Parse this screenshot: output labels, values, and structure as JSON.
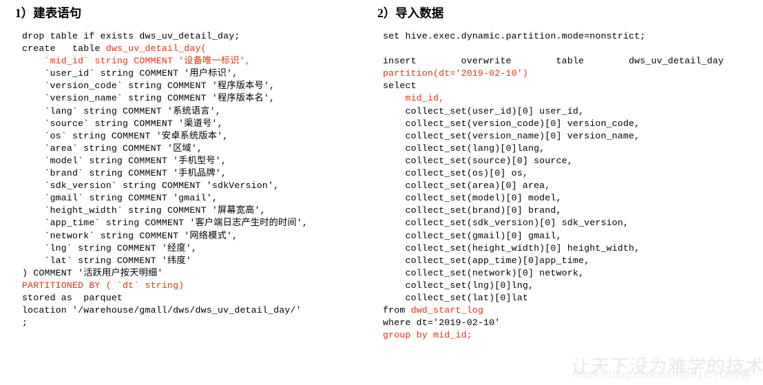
{
  "document": {
    "left_column": {
      "heading": "1）建表语句",
      "code_lines": [
        [
          {
            "t": "drop table if exists dws_uv_detail_day;",
            "c": "black"
          }
        ],
        [
          {
            "t": "create   table ",
            "c": "black"
          },
          {
            "t": "dws_uv_detail_day(",
            "c": "red"
          }
        ],
        [
          {
            "t": "    `mid_id` string COMMENT '设备唯一标识',",
            "c": "red"
          }
        ],
        [
          {
            "t": "    `user_id` string COMMENT '用户标识',",
            "c": "black"
          }
        ],
        [
          {
            "t": "    `version_code` string COMMENT '程序版本号',",
            "c": "black"
          }
        ],
        [
          {
            "t": "    `version_name` string COMMENT '程序版本名',",
            "c": "black"
          }
        ],
        [
          {
            "t": "    `lang` string COMMENT '系统语言',",
            "c": "black"
          }
        ],
        [
          {
            "t": "    `source` string COMMENT '渠道号',",
            "c": "black"
          }
        ],
        [
          {
            "t": "    `os` string COMMENT '安卓系统版本',",
            "c": "black"
          }
        ],
        [
          {
            "t": "    `area` string COMMENT '区域',",
            "c": "black"
          }
        ],
        [
          {
            "t": "    `model` string COMMENT '手机型号',",
            "c": "black"
          }
        ],
        [
          {
            "t": "    `brand` string COMMENT '手机品牌',",
            "c": "black"
          }
        ],
        [
          {
            "t": "    `sdk_version` string COMMENT 'sdkVersion',",
            "c": "black"
          }
        ],
        [
          {
            "t": "    `gmail` string COMMENT 'gmail',",
            "c": "black"
          }
        ],
        [
          {
            "t": "    `height_width` string COMMENT '屏幕宽高',",
            "c": "black"
          }
        ],
        [
          {
            "t": "    `app_time` string COMMENT '客户端日志产生时的时间',",
            "c": "black"
          }
        ],
        [
          {
            "t": "    `network` string COMMENT '网络模式',",
            "c": "black"
          }
        ],
        [
          {
            "t": "    `lng` string COMMENT '经度',",
            "c": "black"
          }
        ],
        [
          {
            "t": "    `lat` string COMMENT '纬度'",
            "c": "black"
          }
        ],
        [
          {
            "t": ") COMMENT '活跃用户按天明细'",
            "c": "black"
          }
        ],
        [
          {
            "t": "PARTITIONED BY ( `dt` string)",
            "c": "red"
          }
        ],
        [
          {
            "t": "stored as  parquet",
            "c": "black"
          }
        ],
        [
          {
            "t": "location '/warehouse/gmall/dws/dws_uv_detail_day/'",
            "c": "black"
          }
        ],
        [
          {
            "t": ";",
            "c": "black"
          }
        ]
      ]
    },
    "right_column": {
      "heading": "2）导入数据",
      "code_lines": [
        [
          {
            "t": "set hive.exec.dynamic.partition.mode=nonstrict;",
            "c": "black"
          }
        ],
        [
          {
            "t": "",
            "c": "black"
          }
        ],
        [
          {
            "t": "insert        overwrite        table        dws_uv_detail_day",
            "c": "black"
          }
        ],
        [
          {
            "t": "partition(dt='2019-02-10')",
            "c": "red"
          }
        ],
        [
          {
            "t": "select",
            "c": "black"
          }
        ],
        [
          {
            "t": "    mid_id,",
            "c": "red"
          }
        ],
        [
          {
            "t": "    collect_set(user_id)[0] user_id,",
            "c": "black"
          }
        ],
        [
          {
            "t": "    collect_set(version_code)[0] version_code,",
            "c": "black"
          }
        ],
        [
          {
            "t": "    collect_set(version_name)[0] version_name,",
            "c": "black"
          }
        ],
        [
          {
            "t": "    collect_set(lang)[0]lang,",
            "c": "black"
          }
        ],
        [
          {
            "t": "    collect_set(source)[0] source,",
            "c": "black"
          }
        ],
        [
          {
            "t": "    collect_set(os)[0] os,",
            "c": "black"
          }
        ],
        [
          {
            "t": "    collect_set(area)[0] area,",
            "c": "black"
          }
        ],
        [
          {
            "t": "    collect_set(model)[0] model,",
            "c": "black"
          }
        ],
        [
          {
            "t": "    collect_set(brand)[0] brand,",
            "c": "black"
          }
        ],
        [
          {
            "t": "    collect_set(sdk_version)[0] sdk_version,",
            "c": "black"
          }
        ],
        [
          {
            "t": "    collect_set(gmail)[0] gmail,",
            "c": "black"
          }
        ],
        [
          {
            "t": "    collect_set(height_width)[0] height_width,",
            "c": "black"
          }
        ],
        [
          {
            "t": "    collect_set(app_time)[0]app_time,",
            "c": "black"
          }
        ],
        [
          {
            "t": "    collect_set(network)[0] network,",
            "c": "black"
          }
        ],
        [
          {
            "t": "    collect_set(lng)[0]lng,",
            "c": "black"
          }
        ],
        [
          {
            "t": "    collect_set(lat)[0]lat",
            "c": "black"
          }
        ],
        [
          {
            "t": "from ",
            "c": "black"
          },
          {
            "t": "dwd_start_log",
            "c": "red"
          }
        ],
        [
          {
            "t": "where dt='2019-02-10'",
            "c": "black"
          }
        ],
        [
          {
            "t": "group by mid_id;",
            "c": "red"
          }
        ]
      ]
    },
    "watermark": {
      "brush_text": "让天下没为难学的技术",
      "url_text": "https://blog.csdnnet/@51CTO博客"
    },
    "colors": {
      "keyword_red": "#e8300c",
      "text_black": "#000000",
      "background": "#ffffff",
      "watermark_gray": "#ececec"
    }
  }
}
